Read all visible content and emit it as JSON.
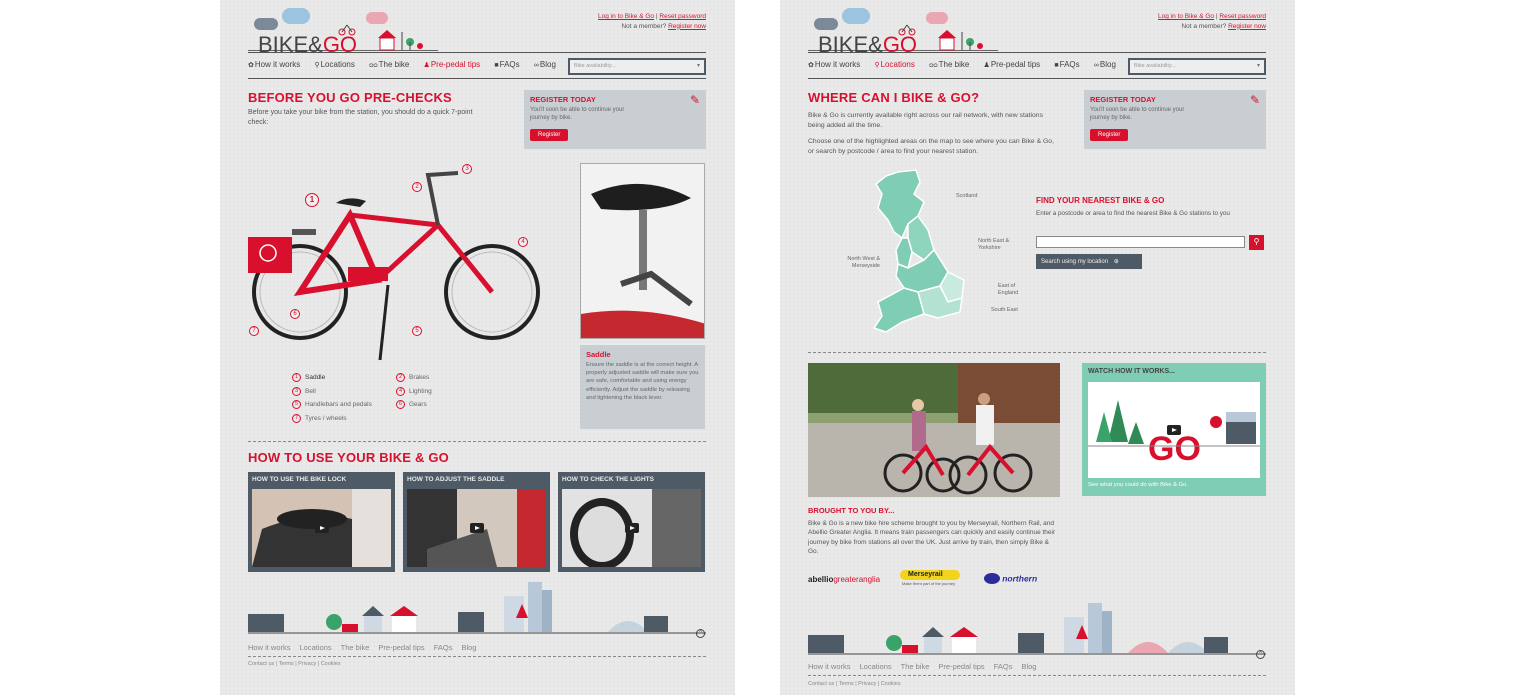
{
  "colors": {
    "brand_red": "#d8102e",
    "slate": "#4e5b66",
    "teal": "#7fcdb4",
    "panel_grey": "#c9ced2"
  },
  "brand": {
    "logo_prefix": "BIKE&",
    "logo_go": "GO"
  },
  "account": {
    "login": "Log in to Bike & Go",
    "separator": "|",
    "reset": "Reset password",
    "not_member": "Not a member?",
    "register_now": "Register now"
  },
  "nav": {
    "how_it_works": "How it works",
    "locations": "Locations",
    "the_bike": "The bike",
    "pre_pedal": "Pre-pedal tips",
    "faqs": "FAQs",
    "blog": "Blog",
    "availability_placeholder": "Bike availability...",
    "icons": {
      "how": "gear-icon",
      "loc": "pin-icon",
      "bike": "bike-icon",
      "tips": "tips-icon",
      "faq": "faq-icon",
      "blog": "chain-icon"
    }
  },
  "register_panel": {
    "title": "REGISTER TODAY",
    "text": "You'll soon be able to continue your journey by bike.",
    "button": "Register"
  },
  "left": {
    "title": "BEFORE YOU GO PRE-CHECKS",
    "intro": "Before you take your bike from the station, you should do a quick 7-point check:",
    "numbers": [
      "1",
      "2",
      "3",
      "4",
      "5",
      "6",
      "7"
    ],
    "legend": [
      {
        "n": "1",
        "label": "Saddle"
      },
      {
        "n": "2",
        "label": "Brakes"
      },
      {
        "n": "3",
        "label": "Bell"
      },
      {
        "n": "4",
        "label": "Lighting"
      },
      {
        "n": "5",
        "label": "Handlebars and pedals"
      },
      {
        "n": "6",
        "label": "Gears"
      },
      {
        "n": "7",
        "label": "Tyres / wheels"
      }
    ],
    "saddle": {
      "title": "Saddle",
      "text": "Ensure the saddle is at the correct height. A properly adjusted saddle will make sure you are safe, comfortable and using energy efficiently. Adjust the saddle by releasing and tightening the black lever."
    },
    "how_to_title": "HOW TO USE YOUR BIKE & GO",
    "videos": [
      {
        "title": "HOW TO USE THE BIKE LOCK"
      },
      {
        "title": "HOW TO ADJUST THE SADDLE"
      },
      {
        "title": "HOW TO CHECK THE LIGHTS"
      }
    ]
  },
  "right": {
    "title": "WHERE CAN I BIKE & GO?",
    "p1": "Bike & Go is currently available right across our rail network, with new stations being added all the time.",
    "p2": "Choose one of the highlighted areas on the map to see where you can Bike & Go, or search by postcode / area to find your nearest station.",
    "map_labels": {
      "scotland": "Scotland",
      "ne": "North East & Yorkshire",
      "nw": "North West & Merseyside",
      "east": "East of England",
      "se": "South East"
    },
    "find": {
      "title": "FIND YOUR NEAREST BIKE & GO",
      "text": "Enter a postcode or area to find the nearest Bike & Go stations to you",
      "search_placeholder": "",
      "location_button": "Search using my location"
    },
    "watch": {
      "title": "WATCH HOW IT WORKS...",
      "caption": "See what you could do with Bike & Go."
    },
    "brought": {
      "title": "BROUGHT TO YOU BY...",
      "text": "Bike & Go is a new bike hire scheme brought to you by Merseyrail, Northern Rail, and Abellio Greater Anglia. It means train passengers can quickly and easily continue their journey by bike from stations all over the UK. Just arrive by train, then simply Bike & Go."
    },
    "partners": {
      "abellio": "abellio",
      "greateranglia": "greateranglia",
      "merseyrail": "Merseyrail",
      "merseyrail_tag": "Make them part of the journey",
      "northern": "northern"
    }
  },
  "footer": {
    "nav": [
      "How it works",
      "Locations",
      "The bike",
      "Pre-pedal tips",
      "FAQs",
      "Blog"
    ],
    "small": [
      "Contact us",
      "Terms",
      "Privacy",
      "Cookies"
    ],
    "up": "^"
  }
}
